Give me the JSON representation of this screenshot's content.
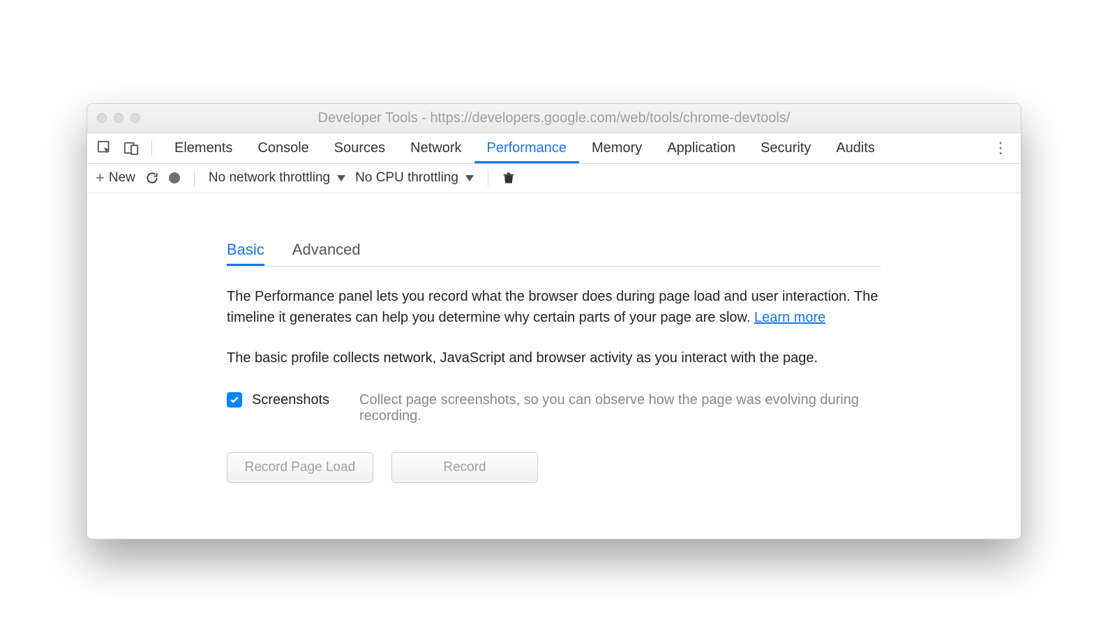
{
  "window": {
    "title": "Developer Tools - https://developers.google.com/web/tools/chrome-devtools/"
  },
  "tabs": {
    "items": [
      {
        "label": "Elements",
        "active": false
      },
      {
        "label": "Console",
        "active": false
      },
      {
        "label": "Sources",
        "active": false
      },
      {
        "label": "Network",
        "active": false
      },
      {
        "label": "Performance",
        "active": true
      },
      {
        "label": "Memory",
        "active": false
      },
      {
        "label": "Application",
        "active": false
      },
      {
        "label": "Security",
        "active": false
      },
      {
        "label": "Audits",
        "active": false
      }
    ]
  },
  "toolbar": {
    "new_label": "New",
    "network_throttle": "No network throttling",
    "cpu_throttle": "No CPU throttling"
  },
  "panel": {
    "sub_tabs": [
      {
        "label": "Basic",
        "active": true
      },
      {
        "label": "Advanced",
        "active": false
      }
    ],
    "intro": "The Performance panel lets you record what the browser does during page load and user interaction. The timeline it generates can help you determine why certain parts of your page are slow.  ",
    "learn_more": "Learn more",
    "basic_desc": "The basic profile collects network, JavaScript and browser activity as you interact with the page.",
    "screenshots": {
      "checked": true,
      "label": "Screenshots",
      "desc": "Collect page screenshots, so you can observe how the page was evolving during recording."
    },
    "buttons": {
      "record_page_load": "Record Page Load",
      "record": "Record"
    }
  }
}
